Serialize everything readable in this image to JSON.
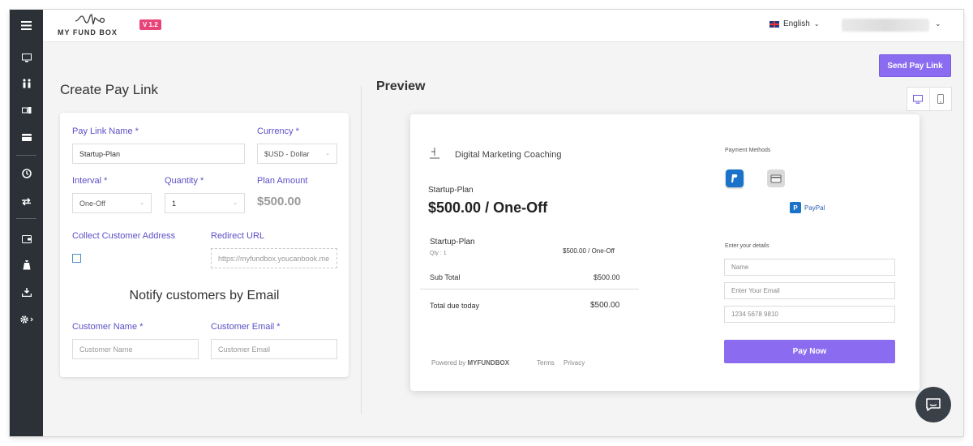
{
  "sidebar": {
    "items": [
      {
        "name": "menu-icon"
      },
      {
        "name": "monitor-icon"
      },
      {
        "name": "users-icon"
      },
      {
        "name": "cards-icon"
      },
      {
        "name": "credit-card-icon"
      },
      {
        "name": "history-icon"
      },
      {
        "name": "repeat-icon"
      },
      {
        "name": "wallet-icon"
      },
      {
        "name": "money-bag-icon"
      },
      {
        "name": "download-icon"
      },
      {
        "name": "gear-icon"
      }
    ]
  },
  "header": {
    "logo_text": "MY FUND BOX",
    "version": "V 1.2",
    "language": "English",
    "user_chevron": "⌄"
  },
  "actions": {
    "send_pay_link": "Send Pay Link"
  },
  "form": {
    "title": "Create Pay Link",
    "pay_link_name_label": "Pay Link Name *",
    "pay_link_name_value": "Startup-Plan",
    "currency_label": "Currency *",
    "currency_value": "$USD - Dollar",
    "interval_label": "Interval *",
    "interval_value": "One-Off",
    "quantity_label": "Quantity *",
    "quantity_value": "1",
    "plan_amount_label": "Plan Amount",
    "plan_amount_value": "$500.00",
    "collect_address_label": "Collect Customer Address",
    "collect_address_checked": false,
    "redirect_url_label": "Redirect URL",
    "redirect_url_placeholder": "https://myfundbox.youcanbook.me",
    "notify_heading": "Notify customers by Email",
    "customer_name_label": "Customer Name *",
    "customer_name_placeholder": "Customer Name",
    "customer_email_label": "Customer Email *",
    "customer_email_placeholder": "Customer Email"
  },
  "preview": {
    "title": "Preview",
    "business_name": "Digital Marketing Coaching",
    "plan_name": "Startup-Plan",
    "price_line": "$500.00 / One-Off",
    "item_name": "Startup-Plan",
    "item_qty": "Qty : 1",
    "item_price": "$500.00 / One-Off",
    "subtotal_label": "Sub Total",
    "subtotal_value": "$500.00",
    "total_label": "Total due today",
    "total_value": "$500.00",
    "powered_by_prefix": "Powered by",
    "powered_by_brand": "MYFUNDBOX",
    "terms": "Terms",
    "privacy": "Privacy",
    "payment_methods_label": "Payment Methods",
    "selected_method": "PayPal",
    "details_label": "Enter your details",
    "name_placeholder": "Name",
    "email_placeholder": "Enter Your Email",
    "card_placeholder": "1234 5678 9810",
    "pay_now": "Pay Now"
  },
  "colors": {
    "accent": "#8b6cf0",
    "label": "#5b4fc7",
    "sidebar": "#2b3137",
    "version_badge": "#e8447a"
  }
}
